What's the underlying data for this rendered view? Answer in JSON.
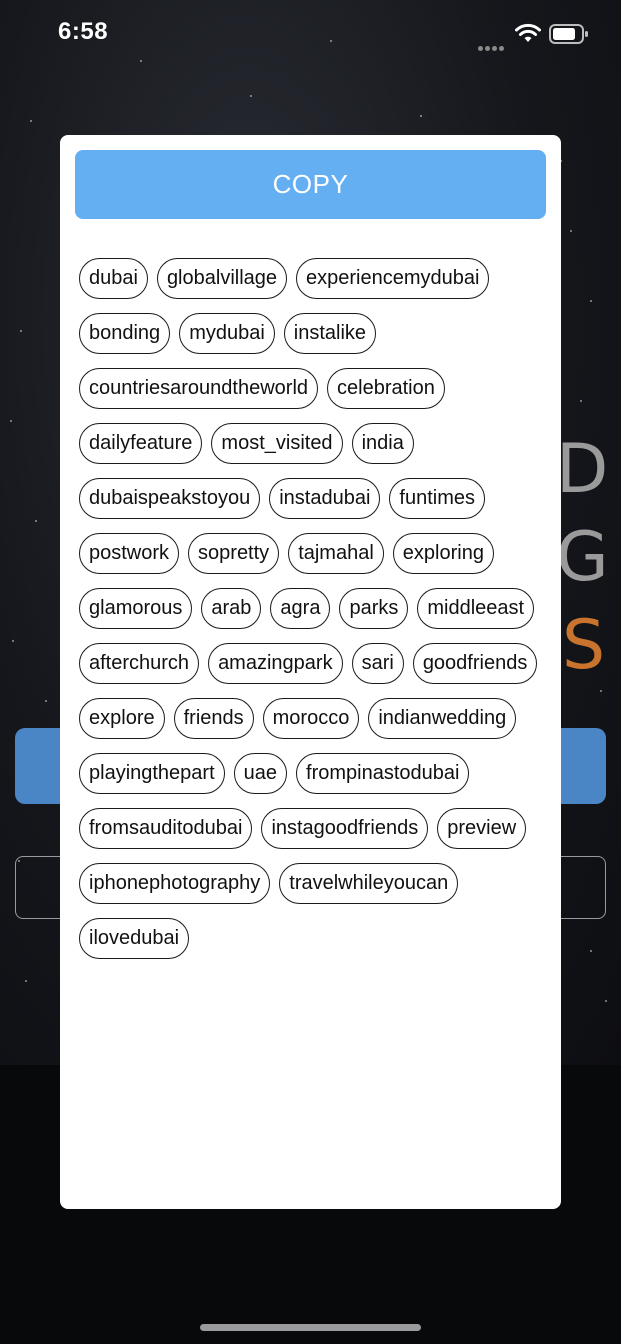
{
  "status_bar": {
    "time": "6:58"
  },
  "background": {
    "letters": [
      "D",
      "G",
      "S"
    ]
  },
  "modal": {
    "copy_label": "COPY",
    "tags": [
      "dubai",
      "globalvillage",
      "experiencemydubai",
      "bonding",
      "mydubai",
      "instalike",
      "countriesaroundtheworld",
      "celebration",
      "dailyfeature",
      "most_visited",
      "india",
      "dubaispeakstoyou",
      "instadubai",
      "funtimes",
      "postwork",
      "sopretty",
      "tajmahal",
      "exploring",
      "glamorous",
      "arab",
      "agra",
      "parks",
      "middleeast",
      "afterchurch",
      "amazingpark",
      "sari",
      "goodfriends",
      "explore",
      "friends",
      "morocco",
      "indianwedding",
      "playingthepart",
      "uae",
      "frompinastodubai",
      "fromsauditodubai",
      "instagoodfriends",
      "preview",
      "iphonephotography",
      "travelwhileyoucan",
      "ilovedubai"
    ]
  },
  "colors": {
    "copy_button": "#64aef2",
    "tag_border": "#1a1a1a",
    "background_accent": "#c8742e"
  }
}
